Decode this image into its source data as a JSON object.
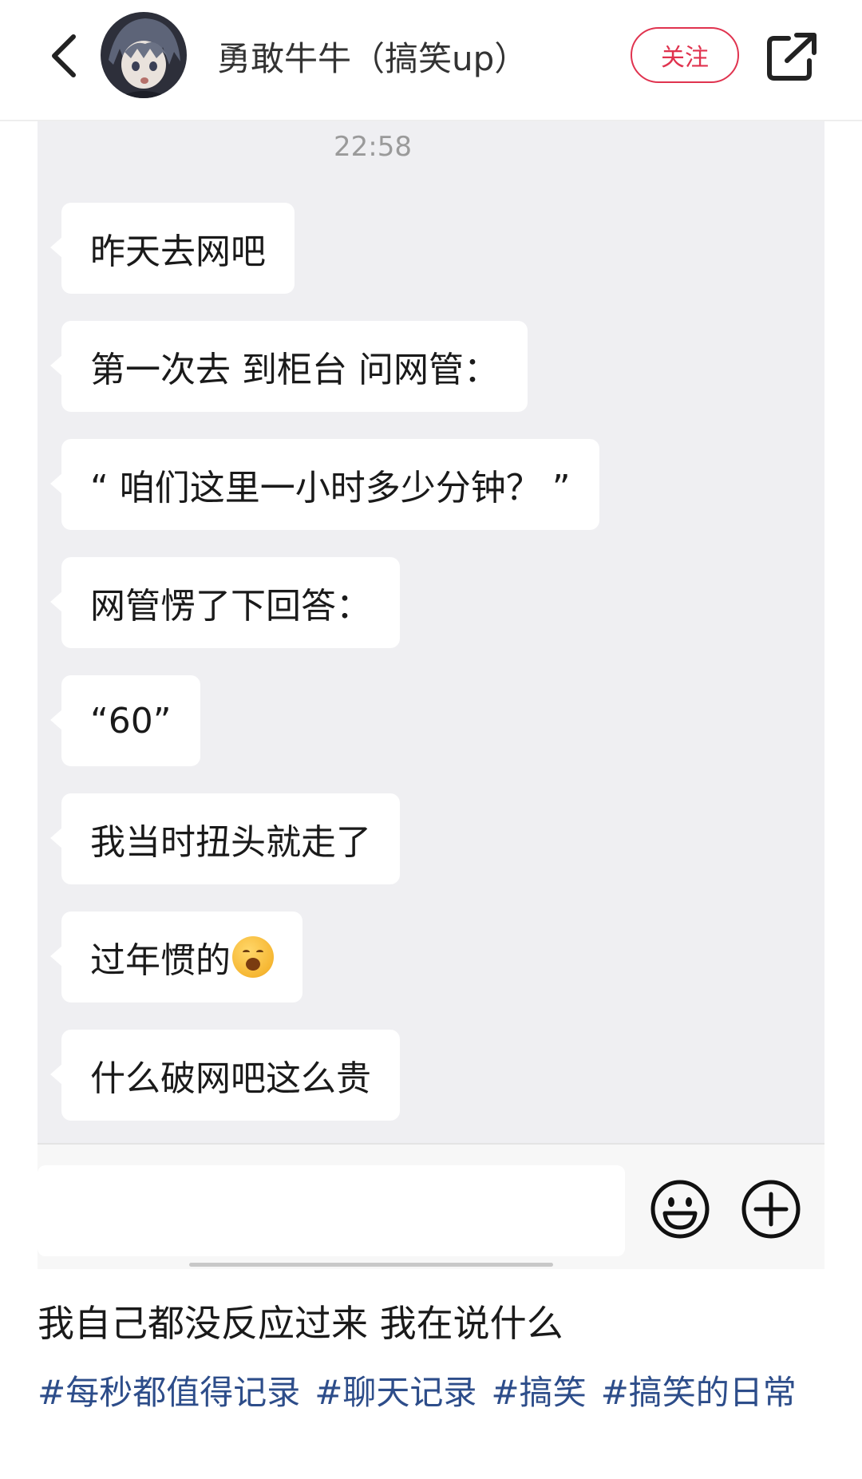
{
  "header": {
    "back_icon": "chevron-left-icon",
    "author_name": "勇敢牛牛（搞笑up）",
    "follow_label": "关注",
    "share_icon": "share-icon"
  },
  "chat": {
    "time": "22:58",
    "messages": [
      "昨天去网吧",
      "第一次去 到柜台 问网管：",
      "“ 咱们这里一小时多少分钟？ ”",
      "网管愣了下回答：",
      "“60”",
      "我当时扭头就走了",
      "过年惯的",
      "什么破网吧这么贵"
    ],
    "input_emoji_icon": "smiley-icon",
    "input_plus_icon": "plus-circle-icon"
  },
  "post": {
    "caption": "我自己都没反应过来 我在说什么",
    "tags": [
      "#每秒都值得记录",
      "#聊天记录",
      "#搞笑",
      "#搞笑的日常"
    ]
  },
  "colors": {
    "accent": "#e0334f",
    "tag": "#2d4d8a",
    "chat_bg": "#efeff2"
  }
}
